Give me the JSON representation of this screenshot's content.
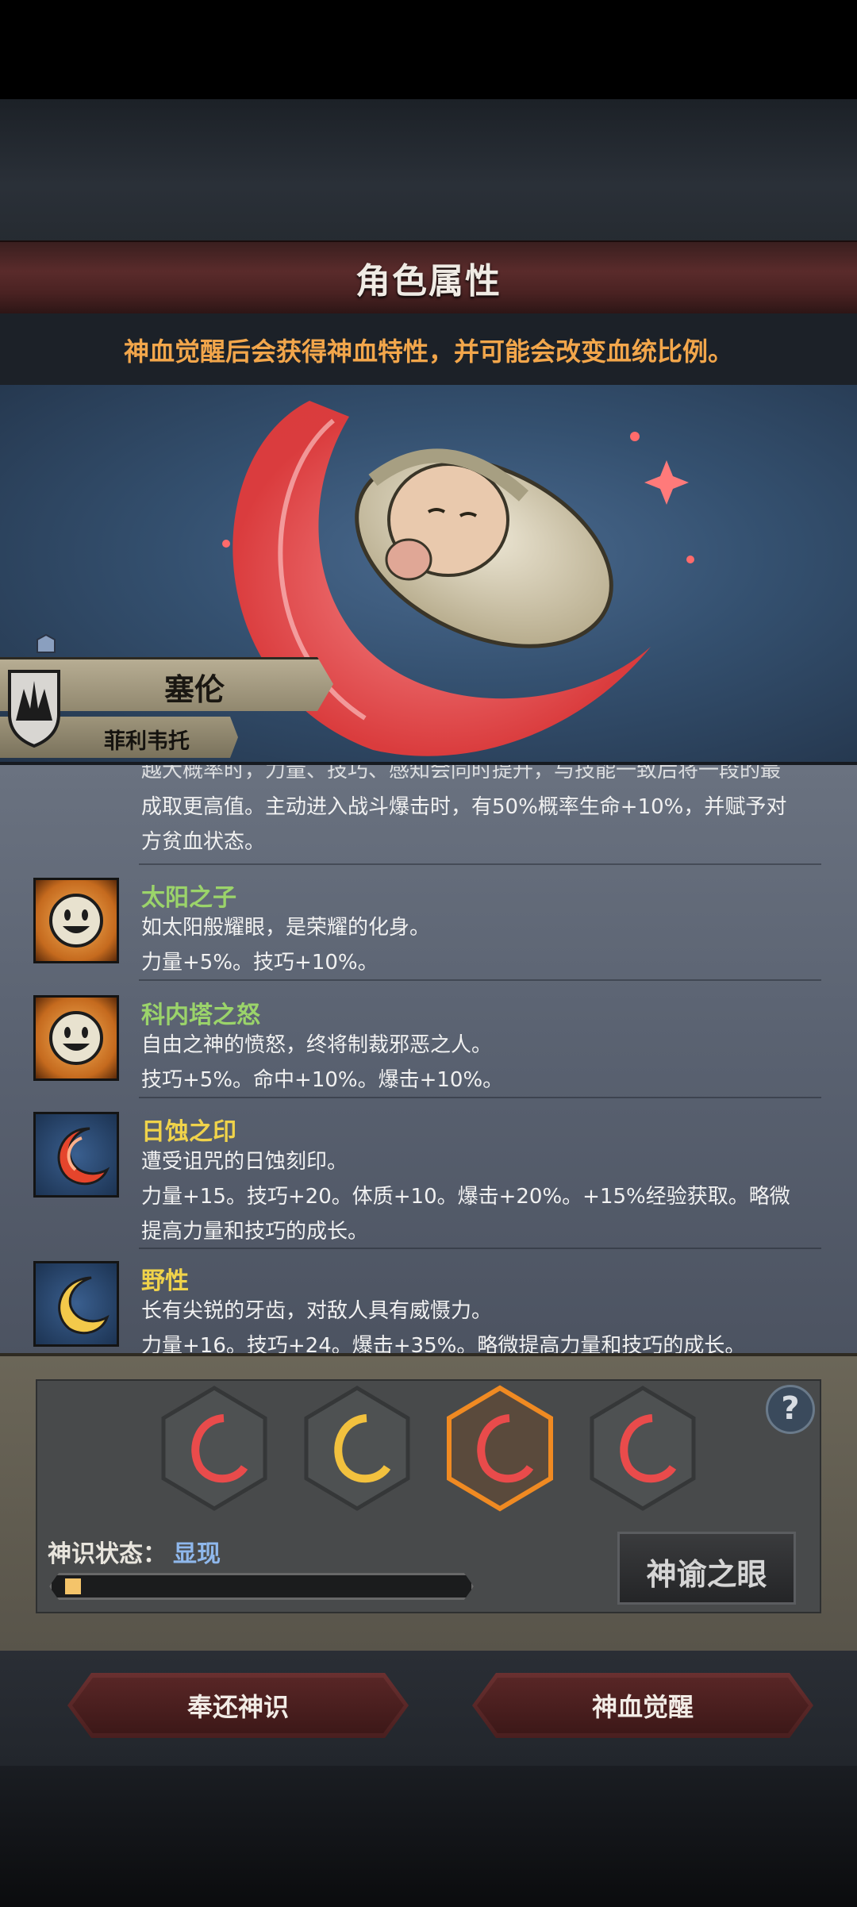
{
  "header": {
    "title": "角色属性",
    "hint": "神血觉醒后会获得神血特性，并可能会改变血统比例。"
  },
  "character": {
    "name": "塞伦",
    "family": "菲利韦托"
  },
  "traits": {
    "partial": {
      "line1": "越大概率时，力量、技巧、感知会同时提升，与技能一致后将一段的最",
      "line2": "成取更高值。主动进入战斗爆击时，有50%概率生命+10%，并赋予对",
      "line3": "方贫血状态。"
    },
    "sun_child": {
      "name": "太阳之子",
      "desc": "如太阳般耀眼，是荣耀的化身。",
      "effect": "力量+5%。技巧+10%。",
      "color": "#9bd46a"
    },
    "konata_wrath": {
      "name": "科内塔之怒",
      "desc": "自由之神的愤怒，终将制裁邪恶之人。",
      "effect": "技巧+5%。命中+10%。爆击+10%。",
      "color": "#9bd46a"
    },
    "eclipse_mark": {
      "name": "日蚀之印",
      "desc": "遭受诅咒的日蚀刻印。",
      "effect1": "力量+15。技巧+20。体质+10。爆击+20%。+15%经验获取。略微",
      "effect2": "提高力量和技巧的成长。",
      "color": "#f0d34a"
    },
    "wild": {
      "name": "野性",
      "desc": "长有尖锐的牙齿，对敌人具有威慑力。",
      "effect": "力量+16。技巧+24。爆击+35%。略微提高力量和技巧的成长。",
      "color": "#f0d34a"
    }
  },
  "divine": {
    "slots": [
      "red",
      "gold",
      "red-selected",
      "red"
    ],
    "status_label": "神识状态：",
    "status_value": "显现",
    "progress": 0.04,
    "help": "?",
    "oracle_button": "神谕之眼"
  },
  "actions": {
    "return": "奉还神识",
    "awaken": "神血觉醒"
  },
  "colors": {
    "banner": "#5a2b2b",
    "hint": "#f2a64b",
    "status_value": "#8fb8ec",
    "progress_fill": "#f4c46a"
  }
}
